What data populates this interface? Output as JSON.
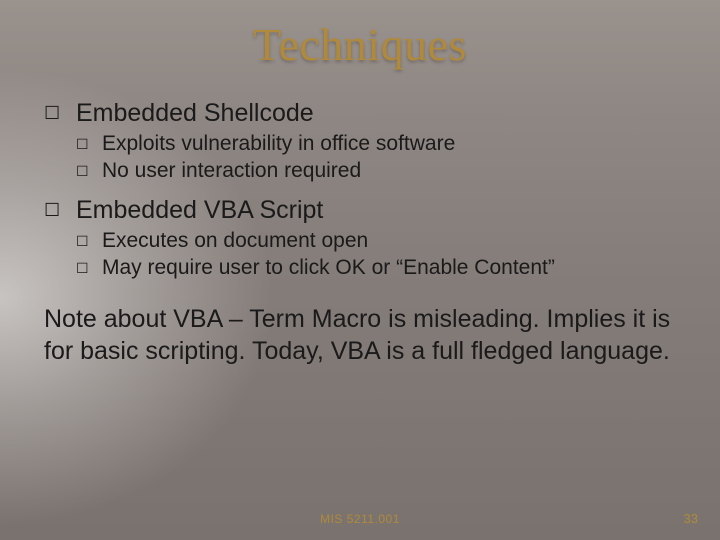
{
  "title": "Techniques",
  "items": [
    {
      "label": "Embedded Shellcode",
      "sub": [
        "Exploits vulnerability in office software",
        "No user interaction required"
      ]
    },
    {
      "label": "Embedded VBA Script",
      "sub": [
        "Executes on document open",
        "May require user to click OK or “Enable Content”"
      ]
    }
  ],
  "note": "Note about VBA – Term Macro is misleading.  Implies it is for basic scripting.  Today, VBA is a full fledged language.",
  "footer": {
    "course": "MIS 5211.001",
    "page": "33"
  },
  "glyph": {
    "square": "☐"
  }
}
